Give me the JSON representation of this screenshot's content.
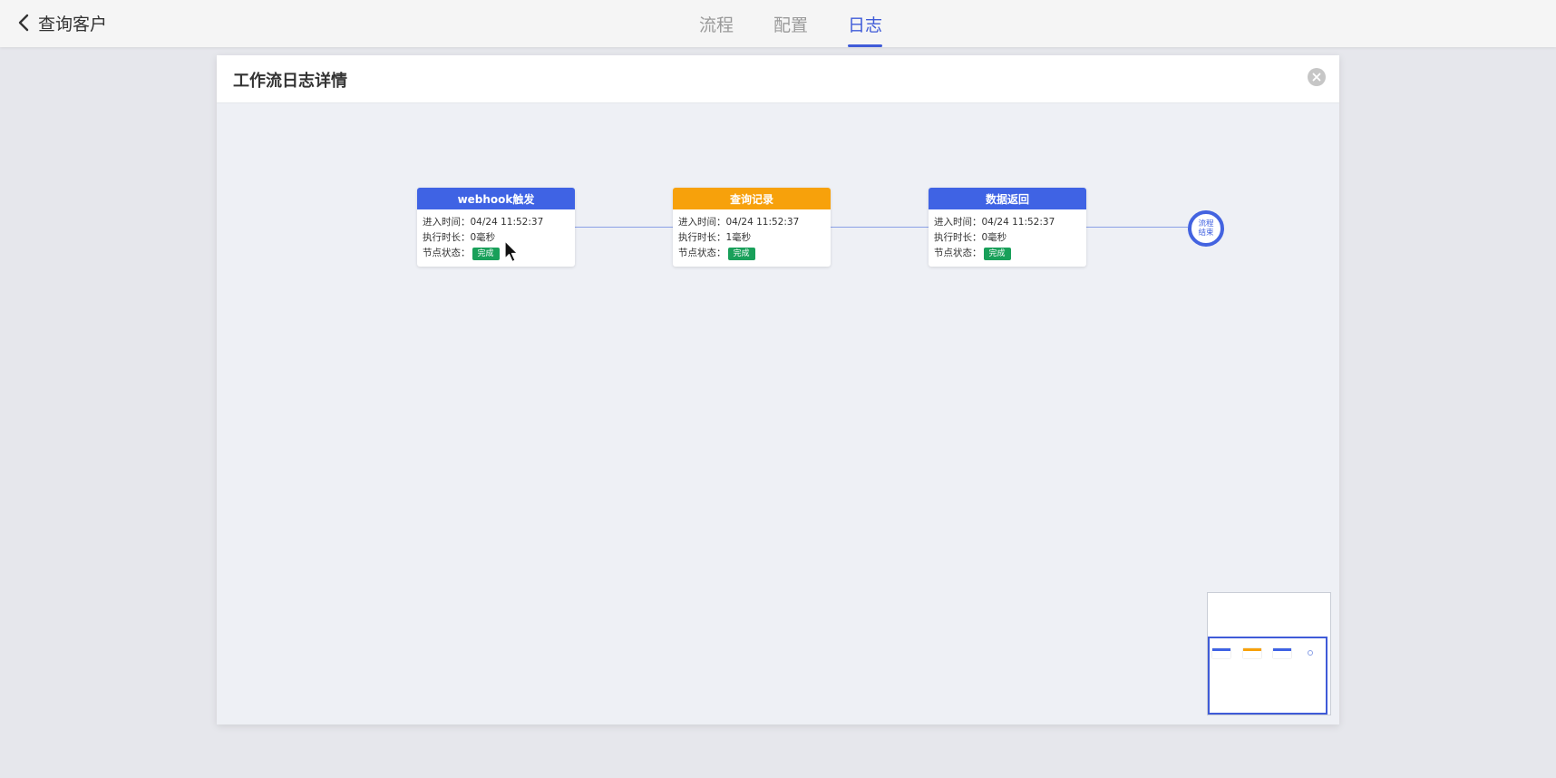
{
  "header": {
    "back_icon": "chevron-left-icon",
    "title": "查询客户",
    "tabs": [
      {
        "label": "流程",
        "active": false
      },
      {
        "label": "配置",
        "active": false
      },
      {
        "label": "日志",
        "active": true
      }
    ],
    "accent_color": "#3f5bd8"
  },
  "modal": {
    "title": "工作流日志详情",
    "close_icon": "close-icon",
    "labels": {
      "enter_time": "进入时间：",
      "duration": "执行时长：",
      "status": "节点状态："
    },
    "nodes": [
      {
        "title": "webhook触发",
        "color": "#3f63e4",
        "enter_time": "04/24 11:52:37",
        "duration": "0毫秒",
        "status": "完成"
      },
      {
        "title": "查询记录",
        "color": "#f7a10b",
        "enter_time": "04/24 11:52:37",
        "duration": "1毫秒",
        "status": "完成"
      },
      {
        "title": "数据返回",
        "color": "#3f63e4",
        "enter_time": "04/24 11:52:37",
        "duration": "0毫秒",
        "status": "完成"
      }
    ],
    "end_node": {
      "label": "流程结束",
      "color": "#4363e0"
    },
    "status_color": "#19a05a"
  }
}
